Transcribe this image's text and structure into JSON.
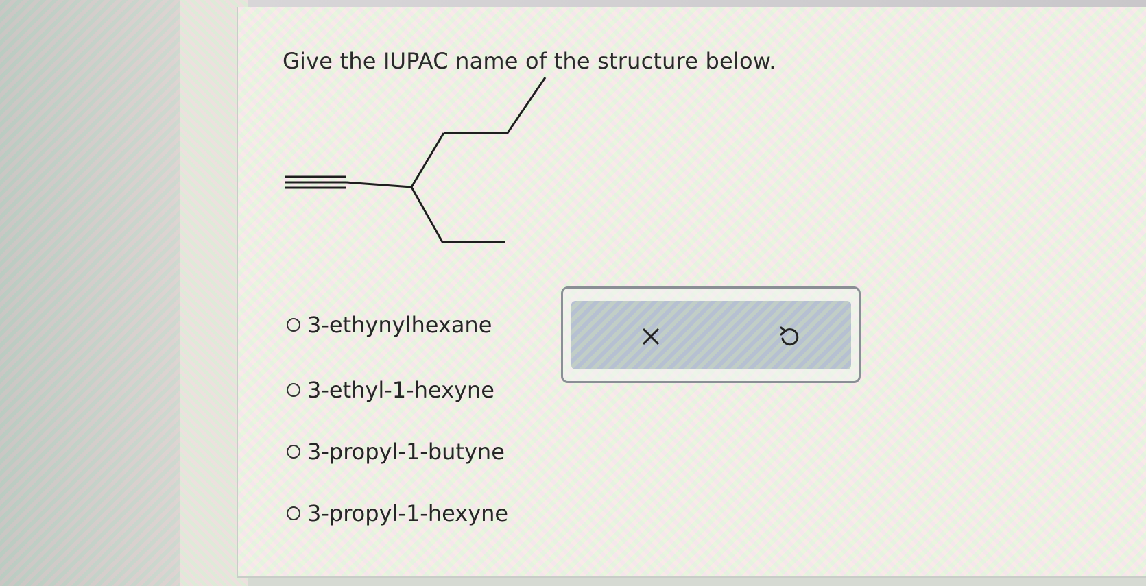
{
  "question": {
    "prompt": "Give the IUPAC name of the structure below."
  },
  "answer_choices": [
    {
      "label": "3-ethynylhexane",
      "selected": false
    },
    {
      "label": "3-ethyl-1-hexyne",
      "selected": false
    },
    {
      "label": "3-propyl-1-butyne",
      "selected": false
    },
    {
      "label": "3-propyl-1-hexyne",
      "selected": false
    }
  ],
  "actions": {
    "clear_icon": "close-icon",
    "undo_icon": "undo-icon"
  },
  "colors": {
    "text": "#262626",
    "bond": "#1e1e1e",
    "action_border": "#8a8f95"
  }
}
